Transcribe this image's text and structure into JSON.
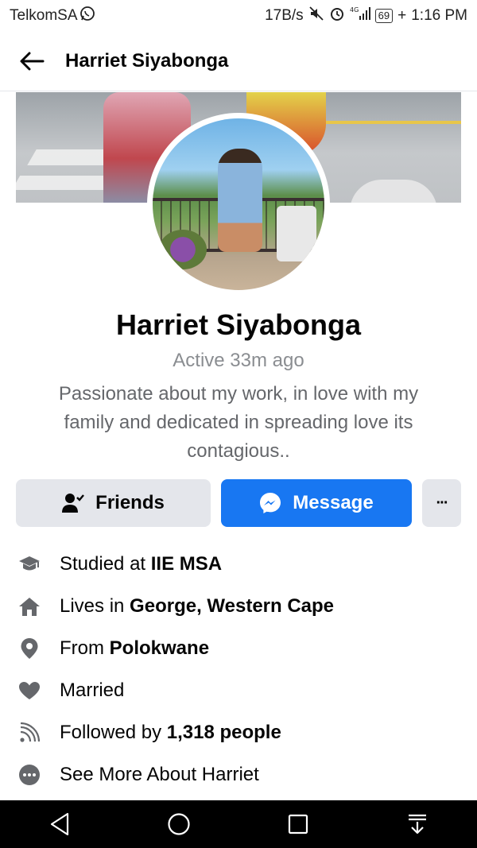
{
  "status_bar": {
    "carrier": "TelkomSA",
    "net_speed": "17B/s",
    "signal_label": "4G",
    "battery": "69",
    "time": "1:16 PM"
  },
  "header": {
    "title": "Harriet Siyabonga"
  },
  "profile": {
    "name": "Harriet Siyabonga",
    "active_status": "Active 33m ago",
    "bio": "Passionate about my work, in love with my family and dedicated in spreading love its contagious.."
  },
  "actions": {
    "friends_label": "Friends",
    "message_label": "Message",
    "more_label": "···"
  },
  "info": {
    "studied_prefix": "Studied at ",
    "studied_value": "IIE MSA",
    "lives_prefix": "Lives in ",
    "lives_value": "George, Western Cape",
    "from_prefix": "From ",
    "from_value": "Polokwane",
    "relationship": "Married",
    "followed_prefix": "Followed by ",
    "followed_value": "1,318 people",
    "see_more": "See More About Harriet"
  },
  "colors": {
    "accent": "#1877f2",
    "secondary_button": "#e4e6eb",
    "muted_text": "#65676b",
    "icon_gray": "#65676b"
  },
  "icons": [
    "whatsapp-icon",
    "mute-icon",
    "alarm-icon",
    "signal-icon",
    "battery-icon",
    "back-arrow-icon",
    "friend-check-icon",
    "messenger-icon",
    "graduation-cap-icon",
    "house-icon",
    "location-pin-icon",
    "heart-icon",
    "rss-feed-icon",
    "more-circle-icon",
    "nav-back-icon",
    "nav-home-icon",
    "nav-recents-icon",
    "nav-notifications-icon"
  ]
}
